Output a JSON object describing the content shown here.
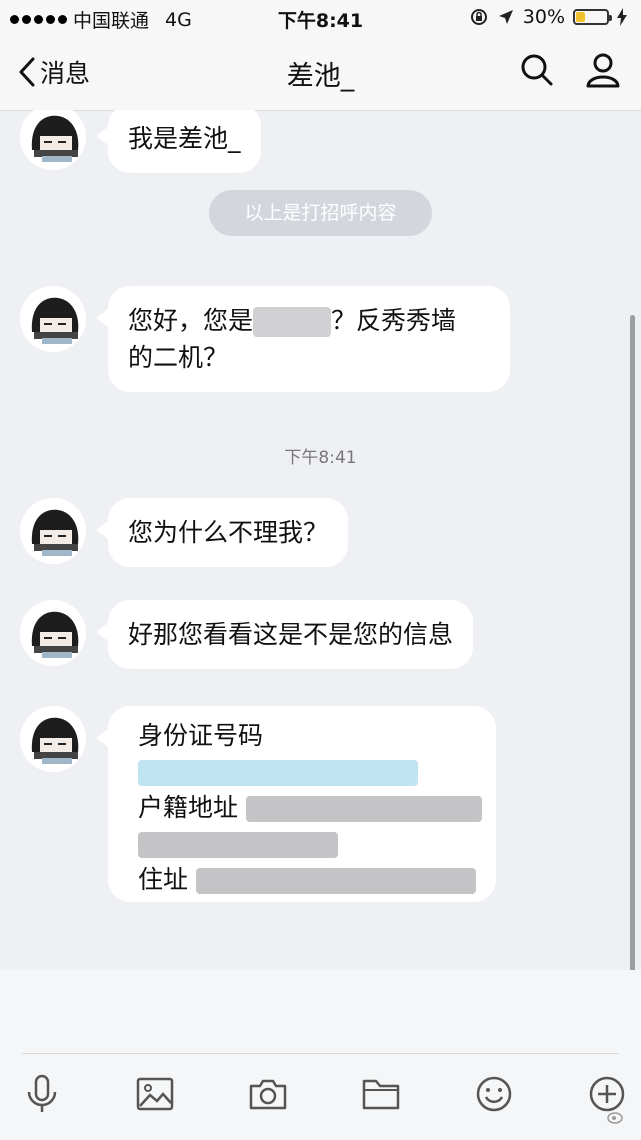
{
  "status": {
    "carrier": "中国联通",
    "network": "4G",
    "time": "下午8:41",
    "battery": "30%",
    "battery_level": 0.3
  },
  "nav": {
    "back_label": "消息",
    "title": "差池_"
  },
  "chat": {
    "first_message": "我是差池_",
    "system_note": "以上是打招呼内容",
    "msg2_part1": "您好，您是",
    "msg2_part2": "？反秀秀墙",
    "msg2_line2": "的二机？",
    "timestamp": "下午8:41",
    "msg3": "您为什么不理我？",
    "msg4": "好那您看看这是不是您的信息",
    "card": {
      "id_label": "身份证号码",
      "address_label": "户籍地址",
      "residence_label": "住址"
    }
  },
  "toolbar": {
    "icons": [
      "microphone-icon",
      "image-icon",
      "camera-icon",
      "folder-icon",
      "emoji-icon",
      "plus-icon"
    ]
  }
}
